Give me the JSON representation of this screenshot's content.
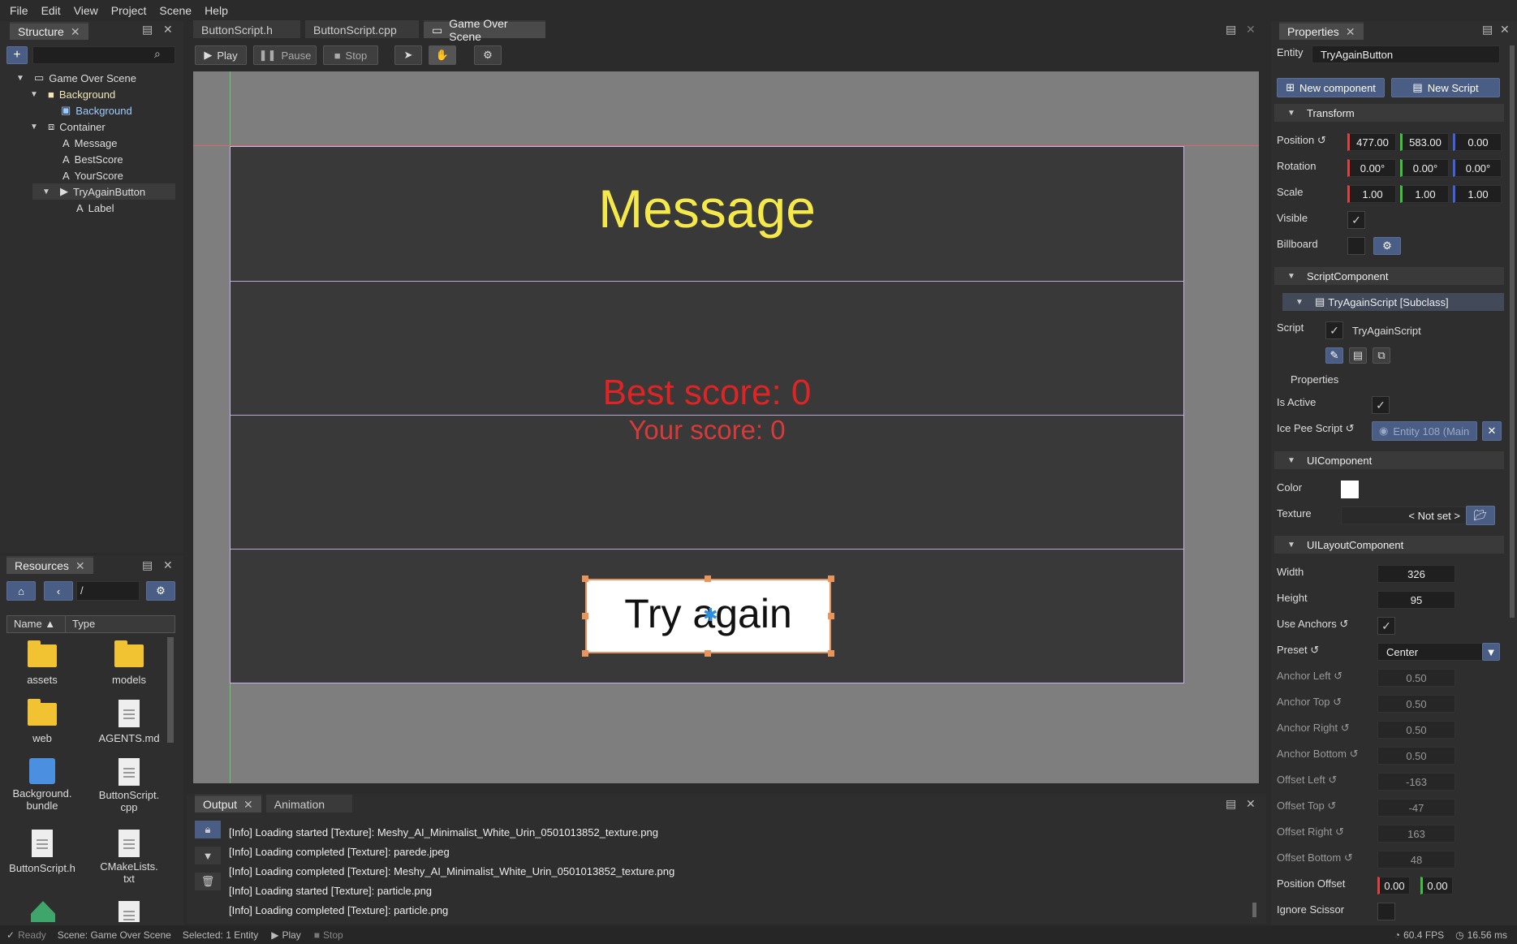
{
  "menu": [
    "File",
    "Edit",
    "View",
    "Project",
    "Scene",
    "Help"
  ],
  "structure": {
    "tab": "Structure",
    "items": [
      {
        "label": "Game Over Scene",
        "icon": "monitor-icon"
      },
      {
        "label": "Background",
        "icon": "cube-icon"
      },
      {
        "label": "Background",
        "icon": "image-icon"
      },
      {
        "label": "Container",
        "icon": "container-icon"
      },
      {
        "label": "Message",
        "icon": "text-icon"
      },
      {
        "label": "BestScore",
        "icon": "text-icon"
      },
      {
        "label": "YourScore",
        "icon": "text-icon"
      },
      {
        "label": "TryAgainButton",
        "icon": "button-icon"
      },
      {
        "label": "Label",
        "icon": "text-icon"
      }
    ]
  },
  "resources": {
    "tab": "Resources",
    "path": "/",
    "col_name": "Name",
    "col_type": "Type",
    "items": [
      {
        "label": "assets",
        "kind": "folder"
      },
      {
        "label": "models",
        "kind": "folder"
      },
      {
        "label": "web",
        "kind": "folder"
      },
      {
        "label": "AGENTS.md",
        "kind": "file"
      },
      {
        "label": "Background.\nbundle",
        "kind": "bundle"
      },
      {
        "label": "ButtonScript.\ncpp",
        "kind": "file"
      },
      {
        "label": "ButtonScript.h",
        "kind": "file"
      },
      {
        "label": "CMakeLists.\ntxt",
        "kind": "file"
      }
    ]
  },
  "editor": {
    "tabs": [
      "ButtonScript.h",
      "ButtonScript.cpp",
      "Game Over Scene"
    ],
    "toolbar": {
      "play": "Play",
      "pause": "Pause",
      "stop": "Stop"
    }
  },
  "scene": {
    "message": "Message",
    "best_score": "Best score: 0",
    "your_score": "Your score: 0",
    "button_label": "Try again",
    "colors": {
      "message": "#f5e94a",
      "best": "#e02424",
      "your": "#d83a3a"
    }
  },
  "properties": {
    "tab": "Properties",
    "entity_label": "Entity",
    "entity": "TryAgainButton",
    "new_component": "New component",
    "new_script": "New Script",
    "transform": {
      "title": "Transform",
      "position_label": "Position",
      "position": [
        "477.00",
        "583.00",
        "0.00"
      ],
      "rotation_label": "Rotation",
      "rotation": [
        "0.00°",
        "0.00°",
        "0.00°"
      ],
      "scale_label": "Scale",
      "scale": [
        "1.00",
        "1.00",
        "1.00"
      ],
      "visible_label": "Visible",
      "billboard_label": "Billboard"
    },
    "script_component": {
      "title": "ScriptComponent",
      "subclass": "TryAgainScript [Subclass]",
      "script_label": "Script",
      "script_name": "TryAgainScript",
      "properties_label": "Properties",
      "is_active_label": "Is Active",
      "ice_pee_label": "Ice Pee Script",
      "ice_pee_value": "Entity 108 (Main"
    },
    "ui_component": {
      "title": "UIComponent",
      "color_label": "Color",
      "texture_label": "Texture",
      "texture_value": "< Not set >"
    },
    "layout": {
      "title": "UILayoutComponent",
      "width_label": "Width",
      "width": "326",
      "height_label": "Height",
      "height": "95",
      "use_anchors_label": "Use Anchors",
      "preset_label": "Preset",
      "preset": "Center",
      "anchor_left_label": "Anchor Left",
      "anchor_left": "0.50",
      "anchor_top_label": "Anchor Top",
      "anchor_top": "0.50",
      "anchor_right_label": "Anchor Right",
      "anchor_right": "0.50",
      "anchor_bottom_label": "Anchor Bottom",
      "anchor_bottom": "0.50",
      "offset_left_label": "Offset Left",
      "offset_left": "-163",
      "offset_top_label": "Offset Top",
      "offset_top": "-47",
      "offset_right_label": "Offset Right",
      "offset_right": "163",
      "offset_bottom_label": "Offset Bottom",
      "offset_bottom": "48",
      "position_offset_label": "Position Offset",
      "position_offset": [
        "0.00",
        "0.00"
      ],
      "ignore_scissor_label": "Ignore Scissor"
    }
  },
  "output": {
    "tabs": [
      "Output",
      "Animation"
    ],
    "lines": [
      "[Info] Loading started [Texture]: Meshy_AI_Minimalist_White_Urin_0501013852_texture.png",
      "[Info] Loading completed [Texture]: parede.jpeg",
      "[Info] Loading completed [Texture]: Meshy_AI_Minimalist_White_Urin_0501013852_texture.png",
      "[Info] Loading started [Texture]: particle.png",
      "[Info] Loading completed [Texture]: particle.png"
    ]
  },
  "status": {
    "ready": "Ready",
    "scene": "Scene: Game Over Scene",
    "selected": "Selected: 1 Entity",
    "play": "Play",
    "stop": "Stop",
    "fps": "60.4 FPS",
    "ms": "16.56 ms"
  }
}
